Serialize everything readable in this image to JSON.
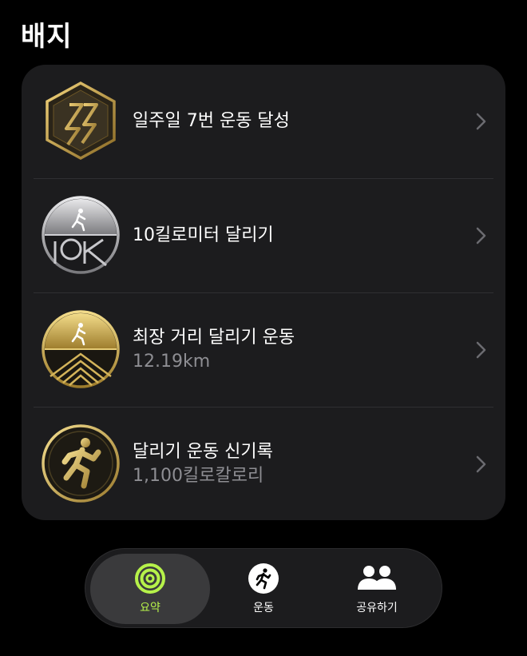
{
  "page": {
    "title": "배지"
  },
  "badges": [
    {
      "label": "일주일 7번 운동 달성",
      "sub": ""
    },
    {
      "label": "10킬로미터 달리기",
      "sub": ""
    },
    {
      "label": "최장 거리 달리기 운동",
      "sub": "12.19km"
    },
    {
      "label": "달리기 운동 신기록",
      "sub": "1,100킬로칼로리"
    }
  ],
  "tabbar": {
    "tabs": [
      {
        "label": "요약",
        "icon": "activity-rings-icon",
        "selected": true
      },
      {
        "label": "운동",
        "icon": "running-figure-icon",
        "selected": false
      },
      {
        "label": "공유하기",
        "icon": "people-icon",
        "selected": false
      }
    ]
  },
  "colors": {
    "accent": "#b6f24a",
    "gold": "#c9a54a",
    "secondary_text": "#8e8e93"
  }
}
